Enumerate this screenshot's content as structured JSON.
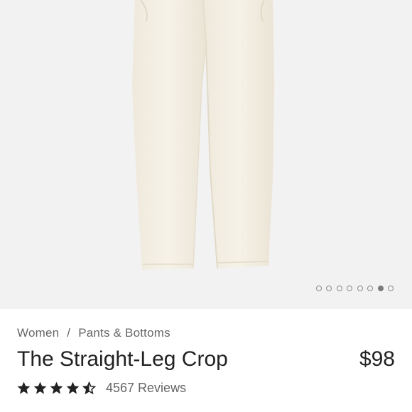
{
  "carousel": {
    "total_slides": 8,
    "active_index": 6
  },
  "breadcrumb": {
    "items": [
      "Women",
      "Pants & Bottoms"
    ],
    "separator": "/"
  },
  "product": {
    "title": "The Straight-Leg Crop",
    "price": "$98",
    "rating": 4.5,
    "reviews_label": "4567 Reviews"
  },
  "colors": {
    "image_background": "#f2f2f2",
    "garment": "#f4efe3",
    "text_primary": "#222222",
    "text_secondary": "#666666"
  },
  "icons": {
    "star": "star-icon",
    "half_star": "star-half-icon"
  }
}
